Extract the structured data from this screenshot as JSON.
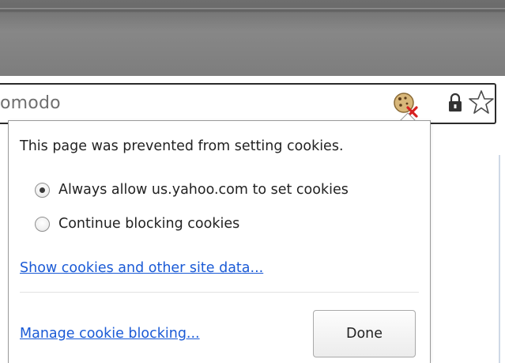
{
  "omnibox": {
    "text": "omodo",
    "cookie_icon": "cookie-blocked-icon",
    "lock_icon": "lock-icon",
    "star_icon": "bookmark-star-icon"
  },
  "cookie_bubble": {
    "title": "This page was prevented from setting cookies.",
    "options": [
      {
        "label": "Always allow us.yahoo.com to set cookies",
        "selected": true
      },
      {
        "label": "Continue blocking cookies",
        "selected": false
      }
    ],
    "show_cookies_link": "Show cookies and other site data...",
    "manage_link": "Manage cookie blocking...",
    "done_label": "Done"
  },
  "colors": {
    "link": "#1a5ad6",
    "text": "#222222",
    "frame": "#7d7d7d",
    "blocked_x": "#d62020"
  }
}
